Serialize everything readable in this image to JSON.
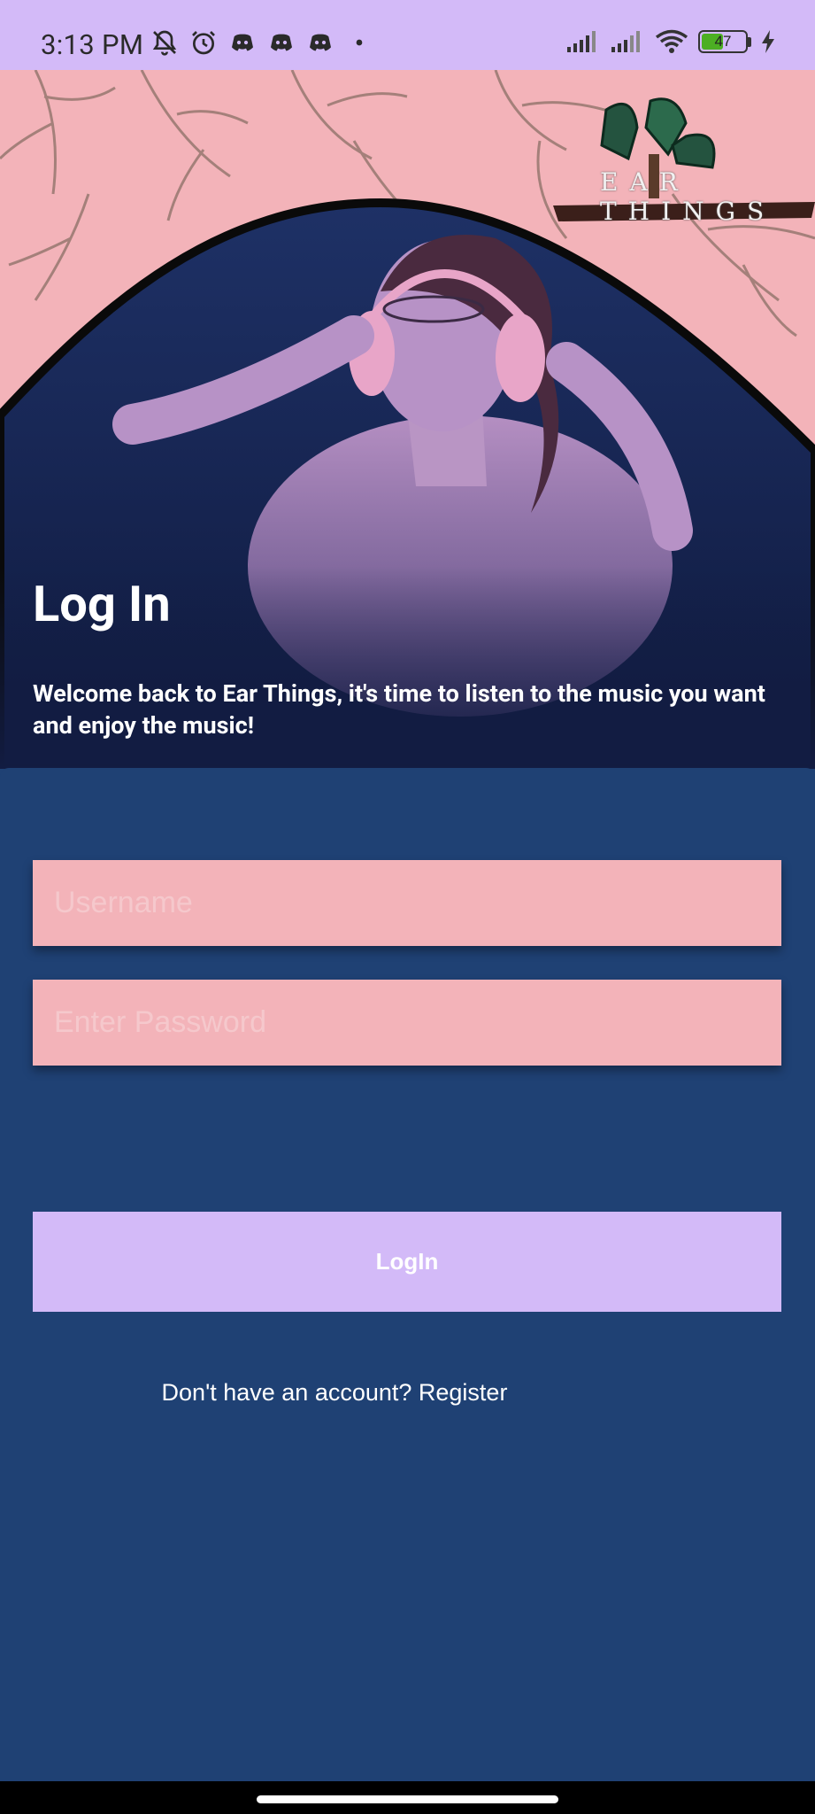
{
  "status_bar": {
    "time": "3:13 PM",
    "left_icons": [
      "bell-off-icon",
      "alarm-icon",
      "discord-icon",
      "discord-icon",
      "discord-icon",
      "dot-icon"
    ],
    "right_icons": [
      "signal-icon",
      "signal-icon",
      "wifi-icon",
      "battery-icon",
      "charging-icon"
    ],
    "battery_level": "47"
  },
  "hero": {
    "logo_text": "EAR THINGS",
    "title": "Log In",
    "subtitle": "Welcome back to Ear Things, it's time to listen to the music you want and enjoy the music!"
  },
  "form": {
    "username_placeholder": "Username",
    "password_placeholder": "Enter Password",
    "login_label": "LogIn",
    "register_text": "Don't have an account? Register"
  },
  "colors": {
    "status_bar": "#d3baf8",
    "hero_background": "#f3b3b9",
    "panel": "#1f4174",
    "field": "#f3b3b9",
    "button": "#d3baf8"
  }
}
